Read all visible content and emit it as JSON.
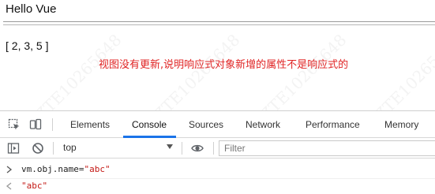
{
  "page": {
    "heading": "Hello Vue",
    "array_text": "[ 2, 3, 5 ]",
    "note": "视图没有更新,说明响应式对象新增的属性不是响应式的",
    "watermark": "ZTE10265648",
    "note_color": "#e02424"
  },
  "devtools": {
    "tabs": [
      {
        "label": "Elements"
      },
      {
        "label": "Console"
      },
      {
        "label": "Sources"
      },
      {
        "label": "Network"
      },
      {
        "label": "Performance"
      },
      {
        "label": "Memory"
      }
    ],
    "active_tab": "Console",
    "accent_color": "#1a73e8",
    "toolbar": {
      "context": "top",
      "filter_placeholder": "Filter"
    },
    "console": {
      "input_prefix": "vm.obj.name=",
      "input_value": "\"abc\"",
      "output_value": "\"abc\""
    }
  }
}
